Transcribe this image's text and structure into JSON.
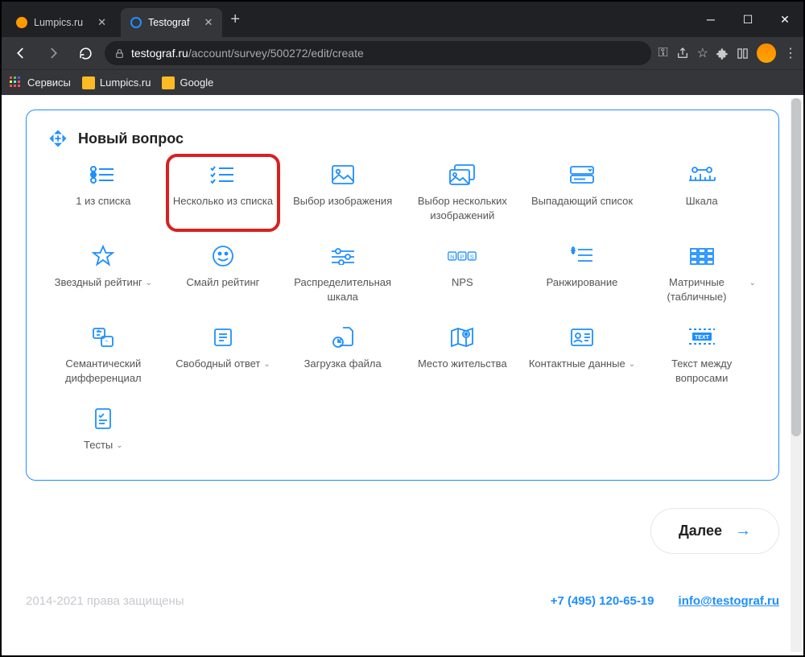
{
  "browser": {
    "tabs": [
      {
        "title": "Lumpics.ru",
        "active": false
      },
      {
        "title": "Testograf",
        "active": true
      }
    ],
    "url_domain": "testograf.ru",
    "url_path": "/account/survey/500272/edit/create",
    "bookmarks": [
      {
        "label": "Сервисы"
      },
      {
        "label": "Lumpics.ru"
      },
      {
        "label": "Google"
      }
    ]
  },
  "panel": {
    "title": "Новый вопрос"
  },
  "qtypes": [
    {
      "label": "1 из списка",
      "icon": "radio-list",
      "chevron": false
    },
    {
      "label": "Несколько из списка",
      "icon": "check-list",
      "chevron": false,
      "highlight": true
    },
    {
      "label": "Выбор изображения",
      "icon": "image",
      "chevron": false
    },
    {
      "label": "Выбор нескольких изображений",
      "icon": "images",
      "chevron": false
    },
    {
      "label": "Выпадающий список",
      "icon": "dropdown",
      "chevron": false
    },
    {
      "label": "Шкала",
      "icon": "scale",
      "chevron": false
    },
    {
      "label": "Звездный рейтинг",
      "icon": "star",
      "chevron": true
    },
    {
      "label": "Смайл рейтинг",
      "icon": "smile",
      "chevron": false
    },
    {
      "label": "Распределительная шкала",
      "icon": "sliders",
      "chevron": false
    },
    {
      "label": "NPS",
      "icon": "nps",
      "chevron": false
    },
    {
      "label": "Ранжирование",
      "icon": "ranking",
      "chevron": false
    },
    {
      "label": "Матричные (табличные)",
      "icon": "matrix",
      "chevron": true
    },
    {
      "label": "Семантический дифференциал",
      "icon": "semantic",
      "chevron": false
    },
    {
      "label": "Свободный ответ",
      "icon": "free-text",
      "chevron": true
    },
    {
      "label": "Загрузка файла",
      "icon": "upload",
      "chevron": false
    },
    {
      "label": "Место жительства",
      "icon": "map-pin",
      "chevron": false
    },
    {
      "label": "Контактные данные",
      "icon": "contact",
      "chevron": true
    },
    {
      "label": "Текст между вопросами",
      "icon": "text-between",
      "chevron": false
    },
    {
      "label": "Тесты",
      "icon": "tests",
      "chevron": true
    }
  ],
  "next_button": "Далее",
  "footer": {
    "copyright": "2014-2021 права защищены",
    "phone": "+7 (495) 120-65-19",
    "email": "info@testograf.ru"
  }
}
